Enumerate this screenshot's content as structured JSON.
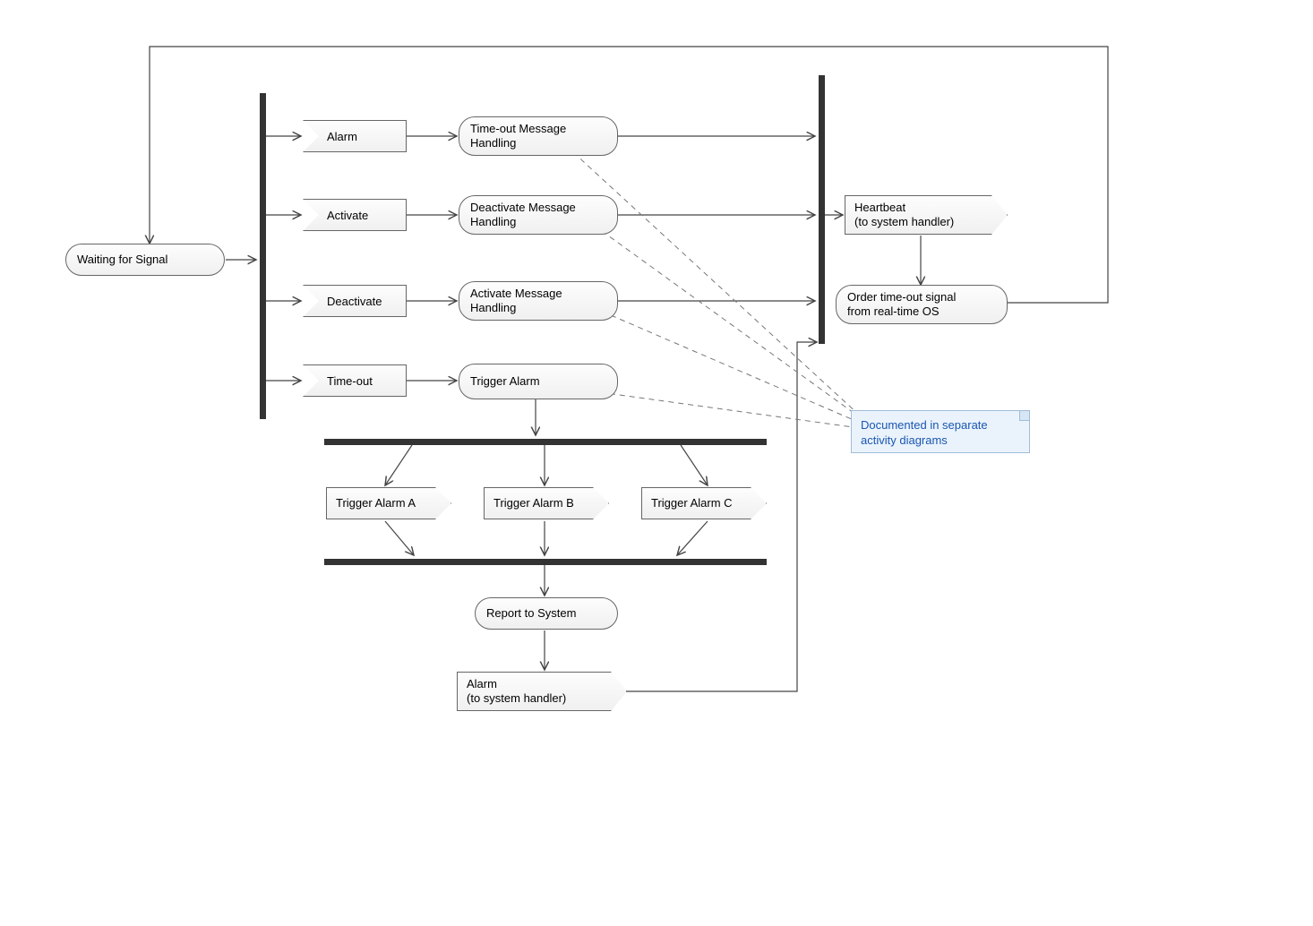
{
  "nodes": {
    "waiting": "Waiting for Signal",
    "alarm": "Alarm",
    "activate": "Activate",
    "deactivate": "Deactivate",
    "timeout": "Time-out",
    "timeoutHandling": "Time-out Message\nHandling",
    "deactivateHandling": "Deactivate Message\nHandling",
    "activateHandling": "Activate Message\nHandling",
    "triggerAlarm": "Trigger Alarm",
    "triggerA": "Trigger Alarm A",
    "triggerB": "Trigger Alarm B",
    "triggerC": "Trigger Alarm C",
    "report": "Report to System",
    "alarmOut": "Alarm\n(to system handler)",
    "heartbeat": "Heartbeat\n(to system handler)",
    "orderTimeout": "Order time-out signal\nfrom real-time OS",
    "note": "Documented in separate\nactivity diagrams"
  }
}
